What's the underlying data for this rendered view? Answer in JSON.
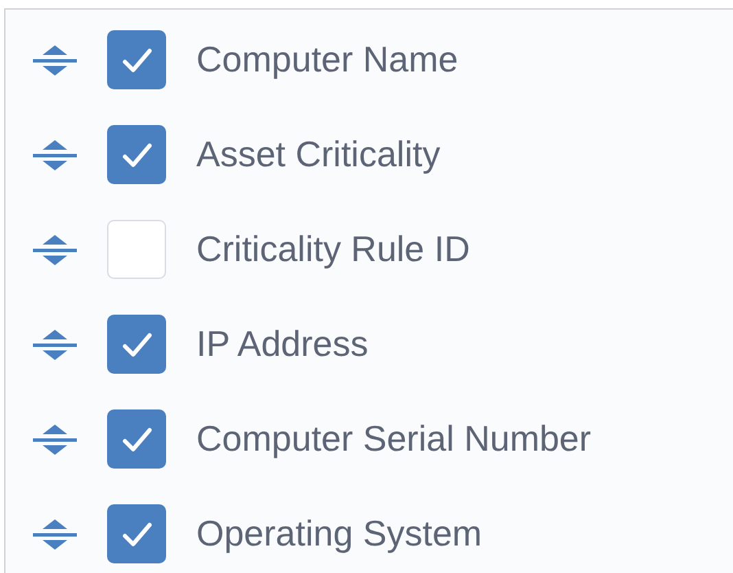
{
  "columns": [
    {
      "label": "Computer Name",
      "checked": true
    },
    {
      "label": "Asset Criticality",
      "checked": true
    },
    {
      "label": "Criticality Rule ID",
      "checked": false
    },
    {
      "label": "IP Address",
      "checked": true
    },
    {
      "label": "Computer Serial Number",
      "checked": true
    },
    {
      "label": "Operating System",
      "checked": true
    }
  ]
}
